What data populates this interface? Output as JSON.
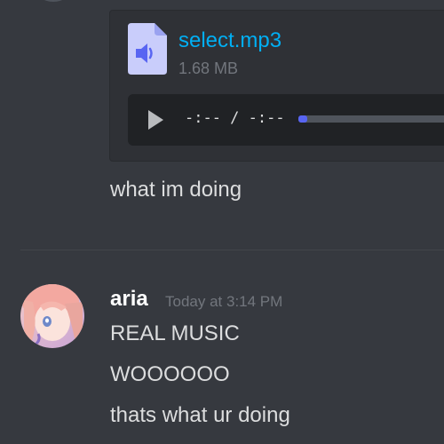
{
  "attachment": {
    "file_name": "select.mp3",
    "file_size": "1.68 MB",
    "icon": "audio-file-icon",
    "player": {
      "time_display": "-:-- / -:--",
      "progress": 0
    }
  },
  "previous_message": {
    "text": "what im doing"
  },
  "message": {
    "author": "aria",
    "timestamp": "Today at 3:14 PM",
    "lines": [
      "REAL MUSIC",
      "WOOOOOO",
      "thats what ur doing"
    ]
  },
  "colors": {
    "background": "#36393f",
    "attachment_bg": "#2f3136",
    "link": "#00aff4",
    "accent": "#5865f2",
    "muted": "#72767d"
  }
}
